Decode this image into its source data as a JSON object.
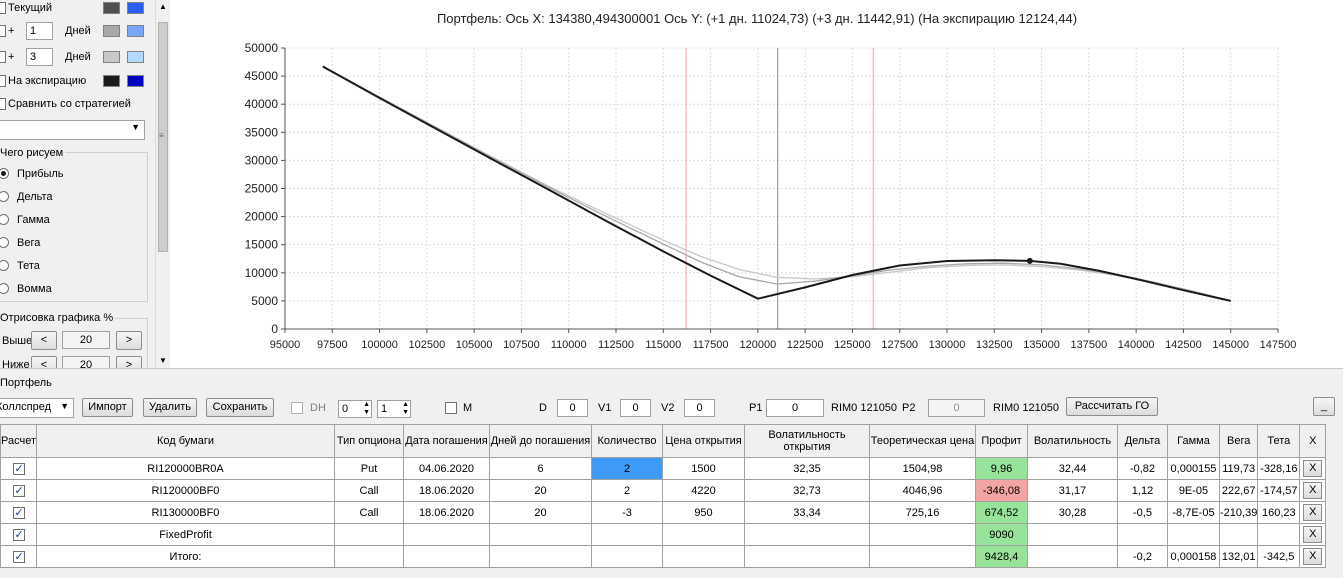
{
  "legend": {
    "current_label": "Текущий",
    "plus1": {
      "sign": "+",
      "days": "1",
      "unit": "Дней"
    },
    "plus3": {
      "sign": "+",
      "days": "3",
      "unit": "Дней"
    },
    "expiry_label": "На экспирацию",
    "compare_label": "Сравнить со стратегией",
    "colors": {
      "current": [
        "#505050",
        "#2a5bff"
      ],
      "plus1": [
        "#a8a8a8",
        "#7aa6f5"
      ],
      "plus3": [
        "#c8c8c8",
        "#b3d9ff"
      ],
      "expiry": [
        "#1a1a1a",
        "#0000c0"
      ]
    }
  },
  "draw_group": {
    "title": "Чего рисуем",
    "options": [
      "Прибыль",
      "Дельта",
      "Гамма",
      "Вега",
      "Тета",
      "Вомма"
    ],
    "selected": 0
  },
  "render_group": {
    "title": "Отрисовка графика %",
    "above_label": "Выше",
    "above_value": "20",
    "below_label": "Ниже",
    "below_value": "20",
    "dec": "<",
    "inc": ">"
  },
  "chart_data": {
    "type": "line",
    "title": "Портфель: Ось X:  134380,494300001 Ось Y:   (+1 дн.  11024,73)  (+3 дн.  11442,91)   (На экспирацию  12124,44)",
    "xlim": [
      95000,
      147500
    ],
    "ylim": [
      0,
      50000
    ],
    "x_ticks": [
      95000,
      97500,
      100000,
      102500,
      105000,
      107500,
      110000,
      112500,
      115000,
      117500,
      120000,
      122500,
      125000,
      127500,
      130000,
      132500,
      135000,
      137500,
      140000,
      142500,
      145000,
      147500
    ],
    "y_ticks": [
      0,
      5000,
      10000,
      15000,
      20000,
      25000,
      30000,
      35000,
      40000,
      45000,
      50000
    ],
    "grid": true,
    "vlines": [
      {
        "x": 116200,
        "color": "#f4a0a0"
      },
      {
        "x": 121050,
        "color": "#8090a8"
      },
      {
        "x": 126100,
        "color": "#f4a0a0"
      }
    ],
    "series": [
      {
        "color": "#c8c8c8",
        "x": [
          97000,
          100000,
          103000,
          106000,
          109000,
          112000,
          115000,
          117000,
          119000,
          121000,
          123000,
          125000,
          127000,
          129000,
          131000,
          133000,
          135000,
          137000,
          139000,
          141000,
          143000,
          145000
        ],
        "y": [
          46700,
          41300,
          35900,
          30500,
          25300,
          20500,
          15800,
          12900,
          10600,
          9200,
          8900,
          9300,
          10100,
          10900,
          11300,
          11400,
          11100,
          10500,
          9500,
          8200,
          6700,
          5000
        ]
      },
      {
        "color": "#a8a8a8",
        "x": [
          97000,
          100000,
          103000,
          106000,
          109000,
          112000,
          115000,
          117000,
          119000,
          121000,
          123000,
          125000,
          127000,
          129000,
          131000,
          133000,
          135000,
          137000,
          139000,
          141000,
          143000,
          145000
        ],
        "y": [
          46700,
          41200,
          35800,
          30400,
          25100,
          20000,
          15100,
          11900,
          9300,
          8000,
          8500,
          9500,
          10500,
          11200,
          11600,
          11700,
          11400,
          10700,
          9700,
          8300,
          6700,
          5000
        ]
      },
      {
        "color": "#1a1a1a",
        "x": [
          97000,
          100000,
          103000,
          106000,
          109000,
          112000,
          115000,
          117500,
          120000,
          122500,
          125000,
          127500,
          130000,
          132500,
          134380,
          136000,
          138000,
          140000,
          142500,
          145000
        ],
        "y": [
          46700,
          41100,
          35600,
          30100,
          24700,
          19200,
          13800,
          9500,
          5400,
          7400,
          9600,
          11300,
          12100,
          12250,
          12124,
          11600,
          10400,
          8900,
          6900,
          5000
        ]
      }
    ],
    "marker": {
      "x": 134380,
      "y": 12124
    }
  },
  "portfolio": {
    "section_label": "Портфель",
    "strategy_value": "Коллспред",
    "import_label": "Импорт",
    "delete_label": "Удалить",
    "save_label": "Сохранить",
    "dh_label": "DH",
    "spin1": "0",
    "spin2": "1",
    "m_label": "M",
    "d_label": "D",
    "d_value": "0",
    "v1_label": "V1",
    "v1_value": "0",
    "v2_label": "V2",
    "v2_value": "0",
    "p1_label": "P1",
    "p1_value": "0",
    "p1_ticker": "RIM0 121050",
    "p2_label": "P2",
    "p2_value": "0",
    "p2_ticker": "RIM0 121050",
    "calc_go_label": "Рассчитать ГО",
    "minimize_label": "_"
  },
  "table": {
    "headers": [
      "Расчет",
      "Код бумаги",
      "Тип опциона",
      "Дата погашения",
      "Дней до погашения",
      "Количество",
      "Цена открытия",
      "Волатильность открытия",
      "Теоретическая цена",
      "Профит",
      "Волатильность",
      "Дельта",
      "Гамма",
      "Вега",
      "Тета",
      "X"
    ],
    "rows": [
      {
        "code": "RI120000BR0A",
        "type": "Put",
        "date": "04.06.2020",
        "days": "6",
        "qty": "2",
        "price": "1500",
        "vol_open": "32,35",
        "theo": "1504,98",
        "profit": "9,96",
        "profit_sign": "pos",
        "vol": "32,44",
        "delta": "-0,82",
        "gamma": "0,000155",
        "vega": "119,73",
        "theta": "-328,16",
        "x": "X"
      },
      {
        "code": "RI120000BF0",
        "type": "Call",
        "date": "18.06.2020",
        "days": "20",
        "qty": "2",
        "price": "4220",
        "vol_open": "32,73",
        "theo": "4046,96",
        "profit": "-346,08",
        "profit_sign": "neg",
        "vol": "31,17",
        "delta": "1,12",
        "gamma": "9E-05",
        "vega": "222,67",
        "theta": "-174,57",
        "x": "X"
      },
      {
        "code": "RI130000BF0",
        "type": "Call",
        "date": "18.06.2020",
        "days": "20",
        "qty": "-3",
        "price": "950",
        "vol_open": "33,34",
        "theo": "725,16",
        "profit": "674,52",
        "profit_sign": "pos",
        "vol": "30,28",
        "delta": "-0,5",
        "gamma": "-8,7E-05",
        "vega": "-210,39",
        "theta": "160,23",
        "x": "X"
      },
      {
        "code": "FixedProfit",
        "type": "",
        "date": "",
        "days": "",
        "qty": "",
        "price": "",
        "vol_open": "",
        "theo": "",
        "profit": "9090",
        "profit_sign": "pos",
        "vol": "",
        "delta": "",
        "gamma": "",
        "vega": "",
        "theta": "",
        "x": "X"
      },
      {
        "code": "Итого:",
        "type": "",
        "date": "",
        "days": "",
        "qty": "",
        "price": "",
        "vol_open": "",
        "theo": "",
        "profit": "9428,4",
        "profit_sign": "pos",
        "vol": "",
        "delta": "-0,2",
        "gamma": "0,000158",
        "vega": "132,01",
        "theta": "-342,5",
        "x": "X"
      }
    ]
  }
}
